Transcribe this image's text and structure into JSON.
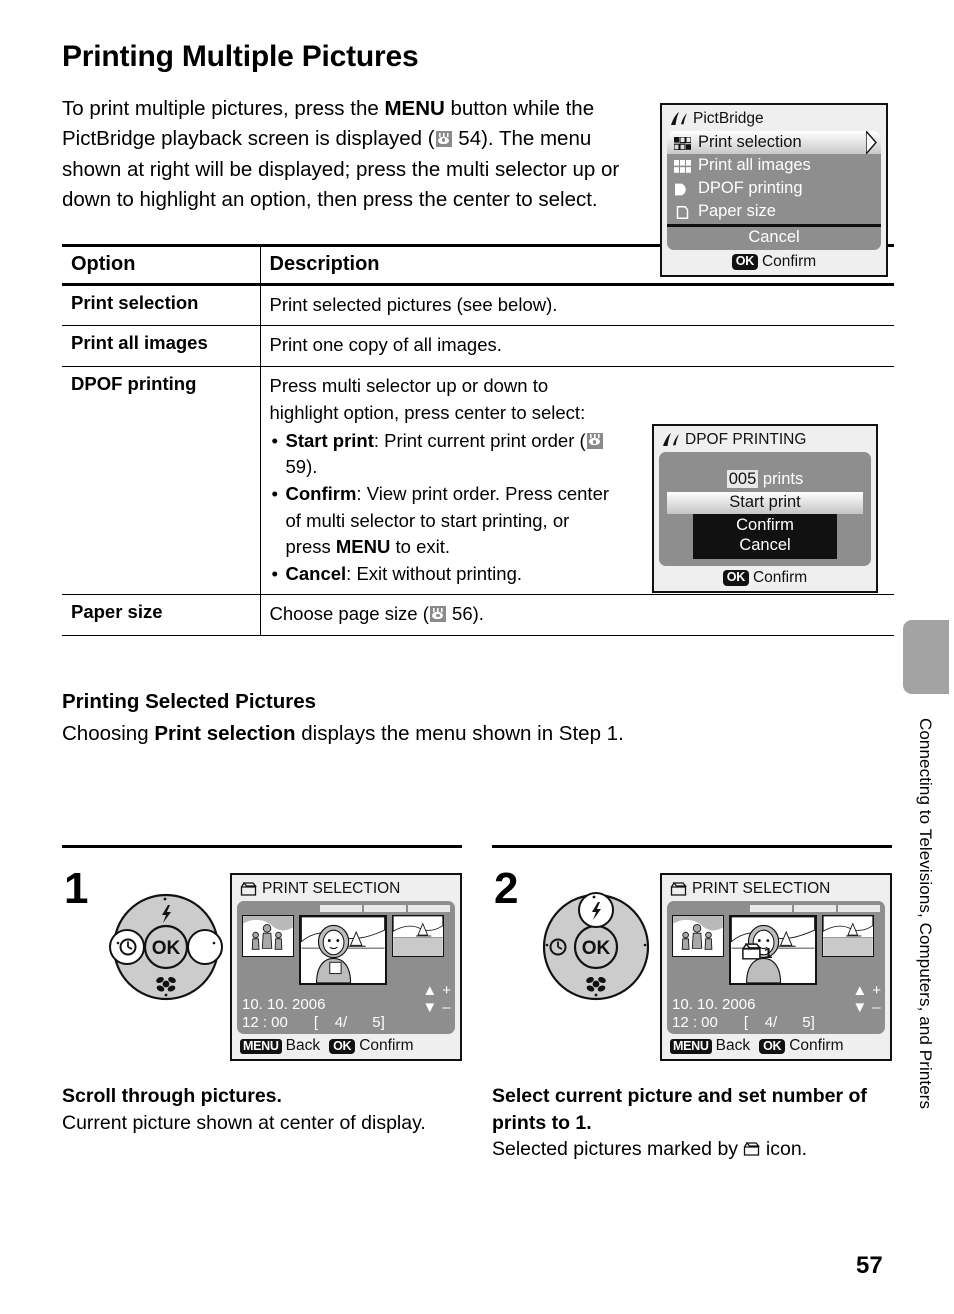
{
  "page": {
    "number": "57",
    "sidebar_chapter": "Connecting to Televisions, Computers, and Printers"
  },
  "heading": "Printing Multiple Pictures",
  "intro": {
    "part1": "To print multiple pictures, press the ",
    "menu_bold": "MENU",
    "part2": " button while the PictBridge playback screen is displayed (",
    "ref_page": "54",
    "part3": "). The menu shown at right will be displayed; press the multi selector up or down to highlight an option, then press the center to select."
  },
  "pictbridge_screen": {
    "title": "PictBridge",
    "items": [
      {
        "label": "Print selection",
        "icon": "grid-mixed-icon",
        "selected": true
      },
      {
        "label": "Print all images",
        "icon": "grid-solid-icon",
        "selected": false
      },
      {
        "label": "DPOF printing",
        "icon": "dpof-d-icon",
        "selected": false
      },
      {
        "label": "Paper size",
        "icon": "page-icon",
        "selected": false
      }
    ],
    "cancel": "Cancel",
    "footer_key": "OK",
    "footer_label": "Confirm"
  },
  "table": {
    "headers": {
      "option": "Option",
      "description": "Description"
    },
    "rows": [
      {
        "option": "Print selection",
        "description": "Print selected pictures (see below)."
      },
      {
        "option": "Print all images",
        "description": "Print one copy of all images."
      },
      {
        "option": "DPOF printing",
        "description": "Press multi selector up or down to highlight option, press center to select:",
        "bullets": [
          {
            "term": "Start print",
            "text": ": Print current print order (",
            "ref": "59",
            "tail": ")."
          },
          {
            "term": "Confirm",
            "text": ": View print order. Press center of multi selector to start printing, or press ",
            "bold_key": "MENU",
            "tail": " to exit."
          },
          {
            "term": "Cancel",
            "text": ": Exit without printing."
          }
        ]
      },
      {
        "option": "Paper size",
        "description": "Choose page size (",
        "ref": "56",
        "tail": ")."
      }
    ]
  },
  "dpof_screen": {
    "title": "DPOF PRINTING",
    "count": "005",
    "count_unit": "prints",
    "items": [
      {
        "label": "Start print",
        "state": "selected"
      },
      {
        "label": "Confirm",
        "state": "normal"
      },
      {
        "label": "Cancel",
        "state": "normal"
      }
    ],
    "footer_key": "OK",
    "footer_label": "Confirm"
  },
  "section2": {
    "heading": "Printing Selected Pictures",
    "intro_a": "Choosing ",
    "intro_bold": "Print selection",
    "intro_b": " displays the menu shown in Step 1."
  },
  "steps": [
    {
      "number": "1",
      "dial": {
        "highlight": "left-right",
        "up_icon": "flash-icon",
        "left_icon": "self-timer-icon",
        "down_icon": "macro-icon",
        "center_label": "OK"
      },
      "screen": {
        "title": "PRINT SELECTION",
        "title_icon": "printer-icon",
        "date": "10. 10. 2006",
        "time": "12 : 00",
        "counter": "[    4/      5]",
        "plus": "+",
        "minus": "–",
        "back_key": "MENU",
        "back_label": "Back",
        "confirm_key": "OK",
        "confirm_label": "Confirm",
        "print_mark": ""
      },
      "caption_bold": "Scroll through pictures.",
      "caption_text": "Current picture shown at center of display."
    },
    {
      "number": "2",
      "dial": {
        "highlight": "up",
        "up_icon": "flash-icon",
        "left_icon": "self-timer-icon",
        "down_icon": "macro-icon",
        "center_label": "OK"
      },
      "screen": {
        "title": "PRINT SELECTION",
        "title_icon": "printer-icon",
        "date": "10. 10. 2006",
        "time": "12 : 00",
        "counter": "[    4/      5]",
        "plus": "+",
        "minus": "–",
        "back_key": "MENU",
        "back_label": "Back",
        "confirm_key": "OK",
        "confirm_label": "Confirm",
        "print_mark": "1"
      },
      "caption_bold": "Select current picture and set number of prints to 1.",
      "caption_text": "Selected pictures marked by",
      "caption_tail": "icon."
    }
  ]
}
